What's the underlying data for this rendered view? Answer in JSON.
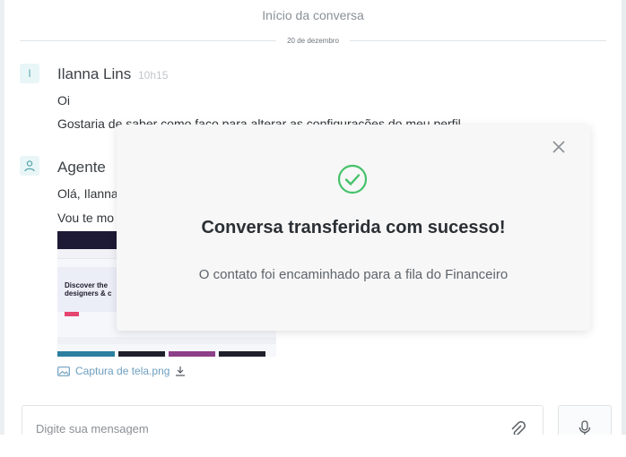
{
  "chat": {
    "start_label": "Início da conversa",
    "date_divider": "20 de dezembro",
    "messages": [
      {
        "avatar_initial": "I",
        "author": "Ilanna Lins",
        "time": "10h15",
        "lines": [
          "Oi",
          "Gostaria de saber como faço para alterar as configurações do meu perfil"
        ]
      },
      {
        "avatar_icon": "user-icon",
        "author": "Agente",
        "lines": [
          "Olá, Ilanna",
          "Vou te mo"
        ]
      }
    ],
    "attachment": {
      "filename": "Captura de tela.png",
      "preview_text": "Discover the designers & c"
    }
  },
  "composer": {
    "placeholder": "Digite sua mensagem"
  },
  "modal": {
    "title": "Conversa transferida com sucesso!",
    "message": "O contato foi encaminhado para a fila do Financeiro"
  },
  "colors": {
    "success": "#45c26b",
    "accent_teal": "#57a6ad",
    "link": "#6d9fc0"
  }
}
